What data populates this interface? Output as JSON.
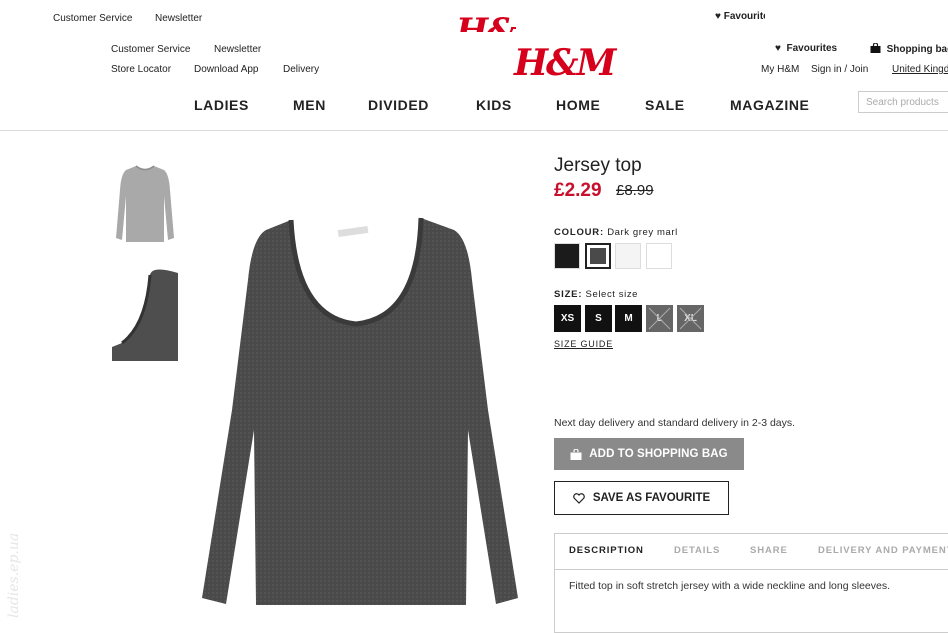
{
  "ghost_header": {
    "links": [
      "Customer Service",
      "Newsletter"
    ],
    "logo": "H&M",
    "favourites": "Favourites"
  },
  "header": {
    "links_row1": [
      "Customer Service",
      "Newsletter"
    ],
    "links_row2": [
      "Store Locator",
      "Download App",
      "Delivery"
    ],
    "logo": "H&M",
    "favourites": "Favourites",
    "shopping_bag": "Shopping bag",
    "my_hm": "My H&M",
    "sign_in": "Sign in / Join",
    "country": "United Kingdom"
  },
  "nav": [
    "LADIES",
    "MEN",
    "DIVIDED",
    "KIDS",
    "HOME",
    "SALE",
    "MAGAZINE"
  ],
  "search": {
    "placeholder": "Search products"
  },
  "product": {
    "title": "Jersey top",
    "price": "£2.29",
    "old_price": "£8.99",
    "colour_label": "COLOUR:",
    "colour_value": "Dark grey marl",
    "swatches": [
      {
        "name": "black",
        "color": "#1b1b1b"
      },
      {
        "name": "dark-grey-marl",
        "color": "#4a4a4a",
        "selected": true
      },
      {
        "name": "light-grey",
        "color": "#f4f4f4"
      },
      {
        "name": "white",
        "color": "#ffffff"
      }
    ],
    "size_label": "SIZE:",
    "size_value": "Select size",
    "sizes": [
      {
        "label": "XS",
        "available": true
      },
      {
        "label": "S",
        "available": true
      },
      {
        "label": "M",
        "available": true
      },
      {
        "label": "L",
        "available": false
      },
      {
        "label": "XL",
        "available": false
      }
    ],
    "size_guide": "SIZE GUIDE",
    "delivery_note": "Next day delivery and standard delivery in 2-3 days.",
    "add_to_bag": "ADD TO SHOPPING BAG",
    "save_favourite": "SAVE AS FAVOURITE"
  },
  "tabs": [
    {
      "label": "DESCRIPTION",
      "active": true
    },
    {
      "label": "DETAILS"
    },
    {
      "label": "SHARE"
    },
    {
      "label": "DELIVERY AND PAYMENT"
    }
  ],
  "description": "Fitted top in soft stretch jersey with a wide neckline and long sleeves.",
  "watermark": "ladies.ep.ua",
  "colors": {
    "brand_red": "#d6001c",
    "price_red": "#c8102e",
    "button_grey": "#8a8a8a"
  }
}
